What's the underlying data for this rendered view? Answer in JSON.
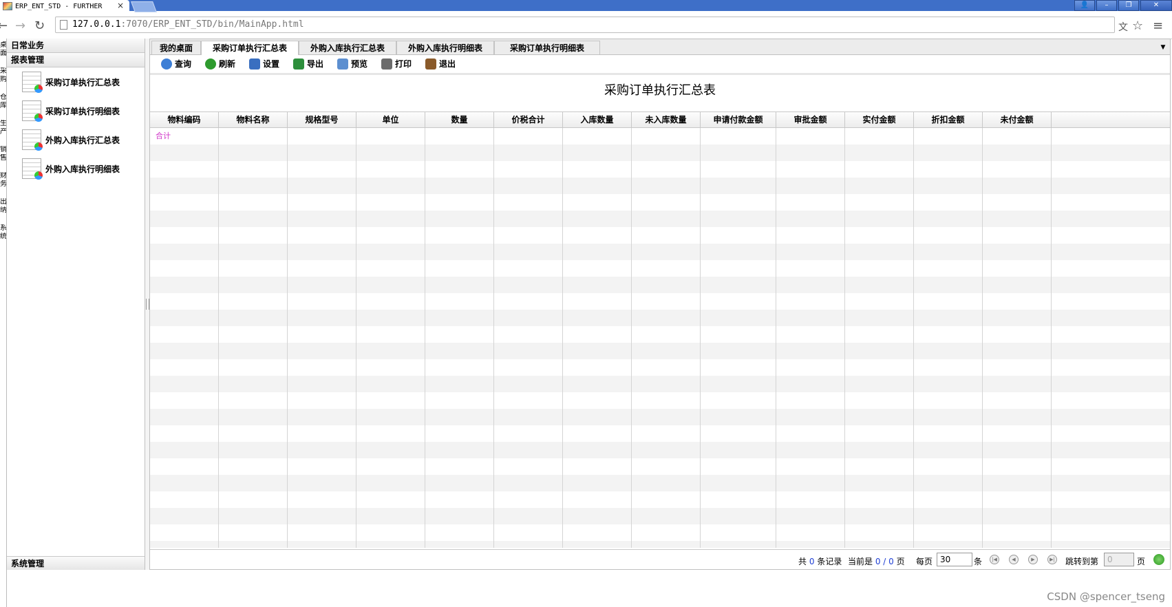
{
  "browser": {
    "tab_title": "ERP_ENT_STD - FURTHER",
    "tab_close": "×",
    "url_host": "127.0.0.1",
    "url_rest": ":7070/ERP_ENT_STD/bin/MainApp.html",
    "window_buttons": [
      "👤",
      "–",
      "❐",
      "✕"
    ],
    "back": "←",
    "forward": "→",
    "reload": "↻",
    "translate": "文",
    "star": "☆",
    "menu": "≡"
  },
  "left_strip": [
    "桌",
    "面",
    "采",
    "购",
    "仓",
    "库",
    "生",
    "产",
    "销",
    "售",
    "财",
    "务",
    "出",
    "纳",
    "系",
    "统"
  ],
  "sidebar": {
    "header1": "日常业务",
    "header2": "报表管理",
    "items": [
      {
        "label": "采购订单执行汇总表"
      },
      {
        "label": "采购订单执行明细表"
      },
      {
        "label": "外购入库执行汇总表"
      },
      {
        "label": "外购入库执行明细表"
      }
    ],
    "footer": "系统管理"
  },
  "tabs": [
    {
      "label": "我的桌面"
    },
    {
      "label": "采购订单执行汇总表"
    },
    {
      "label": "外购入库执行汇总表"
    },
    {
      "label": "外购入库执行明细表"
    },
    {
      "label": "采购订单执行明细表"
    }
  ],
  "tab_menu": "▼",
  "toolbar": [
    {
      "label": "查询",
      "color": "#3d7fd6"
    },
    {
      "label": "刷新",
      "color": "#2e9b2e"
    },
    {
      "label": "设置",
      "color": "#3a6fc0"
    },
    {
      "label": "导出",
      "color": "#2d8f3c"
    },
    {
      "label": "预览",
      "color": "#5c8fd0"
    },
    {
      "label": "打印",
      "color": "#6c6c6c"
    },
    {
      "label": "退出",
      "color": "#8a5a2a"
    }
  ],
  "report_title": "采购订单执行汇总表",
  "columns": [
    "物料编码",
    "物料名称",
    "规格型号",
    "单位",
    "数量",
    "价税合计",
    "入库数量",
    "未入库数量",
    "申请付款金额",
    "审批金额",
    "实付金额",
    "折扣金额",
    "未付金额"
  ],
  "sum_row_label": "合计",
  "pager": {
    "total_prefix": "共",
    "total": "0",
    "total_suffix": "条记录",
    "current_prefix": "当前是",
    "current": "0 / 0",
    "current_suffix": "页",
    "per_page_prefix": "每页",
    "per_page": "30",
    "per_page_suffix": "条",
    "jump_prefix": "跳转到第",
    "jump_value": "0",
    "jump_suffix": "页"
  },
  "credit": "CSDN @spencer_tseng"
}
